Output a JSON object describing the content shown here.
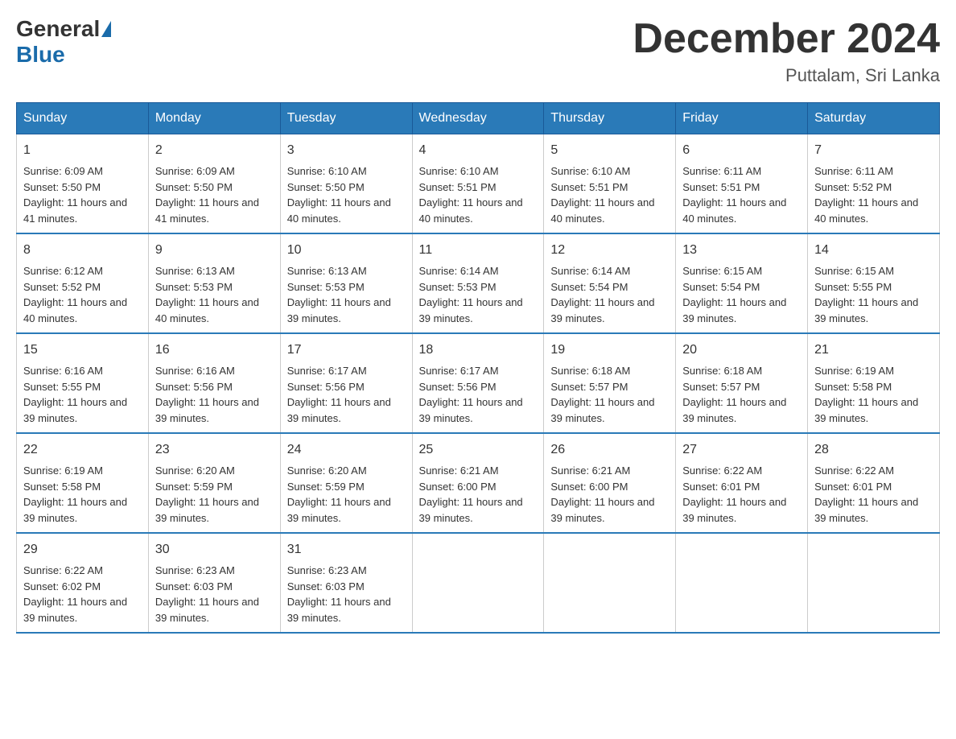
{
  "header": {
    "logo_general": "General",
    "logo_blue": "Blue",
    "title": "December 2024",
    "location": "Puttalam, Sri Lanka"
  },
  "weekdays": [
    "Sunday",
    "Monday",
    "Tuesday",
    "Wednesday",
    "Thursday",
    "Friday",
    "Saturday"
  ],
  "weeks": [
    [
      {
        "day": "1",
        "sunrise": "6:09 AM",
        "sunset": "5:50 PM",
        "daylight": "11 hours and 41 minutes."
      },
      {
        "day": "2",
        "sunrise": "6:09 AM",
        "sunset": "5:50 PM",
        "daylight": "11 hours and 41 minutes."
      },
      {
        "day": "3",
        "sunrise": "6:10 AM",
        "sunset": "5:50 PM",
        "daylight": "11 hours and 40 minutes."
      },
      {
        "day": "4",
        "sunrise": "6:10 AM",
        "sunset": "5:51 PM",
        "daylight": "11 hours and 40 minutes."
      },
      {
        "day": "5",
        "sunrise": "6:10 AM",
        "sunset": "5:51 PM",
        "daylight": "11 hours and 40 minutes."
      },
      {
        "day": "6",
        "sunrise": "6:11 AM",
        "sunset": "5:51 PM",
        "daylight": "11 hours and 40 minutes."
      },
      {
        "day": "7",
        "sunrise": "6:11 AM",
        "sunset": "5:52 PM",
        "daylight": "11 hours and 40 minutes."
      }
    ],
    [
      {
        "day": "8",
        "sunrise": "6:12 AM",
        "sunset": "5:52 PM",
        "daylight": "11 hours and 40 minutes."
      },
      {
        "day": "9",
        "sunrise": "6:13 AM",
        "sunset": "5:53 PM",
        "daylight": "11 hours and 40 minutes."
      },
      {
        "day": "10",
        "sunrise": "6:13 AM",
        "sunset": "5:53 PM",
        "daylight": "11 hours and 39 minutes."
      },
      {
        "day": "11",
        "sunrise": "6:14 AM",
        "sunset": "5:53 PM",
        "daylight": "11 hours and 39 minutes."
      },
      {
        "day": "12",
        "sunrise": "6:14 AM",
        "sunset": "5:54 PM",
        "daylight": "11 hours and 39 minutes."
      },
      {
        "day": "13",
        "sunrise": "6:15 AM",
        "sunset": "5:54 PM",
        "daylight": "11 hours and 39 minutes."
      },
      {
        "day": "14",
        "sunrise": "6:15 AM",
        "sunset": "5:55 PM",
        "daylight": "11 hours and 39 minutes."
      }
    ],
    [
      {
        "day": "15",
        "sunrise": "6:16 AM",
        "sunset": "5:55 PM",
        "daylight": "11 hours and 39 minutes."
      },
      {
        "day": "16",
        "sunrise": "6:16 AM",
        "sunset": "5:56 PM",
        "daylight": "11 hours and 39 minutes."
      },
      {
        "day": "17",
        "sunrise": "6:17 AM",
        "sunset": "5:56 PM",
        "daylight": "11 hours and 39 minutes."
      },
      {
        "day": "18",
        "sunrise": "6:17 AM",
        "sunset": "5:56 PM",
        "daylight": "11 hours and 39 minutes."
      },
      {
        "day": "19",
        "sunrise": "6:18 AM",
        "sunset": "5:57 PM",
        "daylight": "11 hours and 39 minutes."
      },
      {
        "day": "20",
        "sunrise": "6:18 AM",
        "sunset": "5:57 PM",
        "daylight": "11 hours and 39 minutes."
      },
      {
        "day": "21",
        "sunrise": "6:19 AM",
        "sunset": "5:58 PM",
        "daylight": "11 hours and 39 minutes."
      }
    ],
    [
      {
        "day": "22",
        "sunrise": "6:19 AM",
        "sunset": "5:58 PM",
        "daylight": "11 hours and 39 minutes."
      },
      {
        "day": "23",
        "sunrise": "6:20 AM",
        "sunset": "5:59 PM",
        "daylight": "11 hours and 39 minutes."
      },
      {
        "day": "24",
        "sunrise": "6:20 AM",
        "sunset": "5:59 PM",
        "daylight": "11 hours and 39 minutes."
      },
      {
        "day": "25",
        "sunrise": "6:21 AM",
        "sunset": "6:00 PM",
        "daylight": "11 hours and 39 minutes."
      },
      {
        "day": "26",
        "sunrise": "6:21 AM",
        "sunset": "6:00 PM",
        "daylight": "11 hours and 39 minutes."
      },
      {
        "day": "27",
        "sunrise": "6:22 AM",
        "sunset": "6:01 PM",
        "daylight": "11 hours and 39 minutes."
      },
      {
        "day": "28",
        "sunrise": "6:22 AM",
        "sunset": "6:01 PM",
        "daylight": "11 hours and 39 minutes."
      }
    ],
    [
      {
        "day": "29",
        "sunrise": "6:22 AM",
        "sunset": "6:02 PM",
        "daylight": "11 hours and 39 minutes."
      },
      {
        "day": "30",
        "sunrise": "6:23 AM",
        "sunset": "6:03 PM",
        "daylight": "11 hours and 39 minutes."
      },
      {
        "day": "31",
        "sunrise": "6:23 AM",
        "sunset": "6:03 PM",
        "daylight": "11 hours and 39 minutes."
      },
      null,
      null,
      null,
      null
    ]
  ],
  "labels": {
    "sunrise_prefix": "Sunrise: ",
    "sunset_prefix": "Sunset: ",
    "daylight_prefix": "Daylight: "
  }
}
